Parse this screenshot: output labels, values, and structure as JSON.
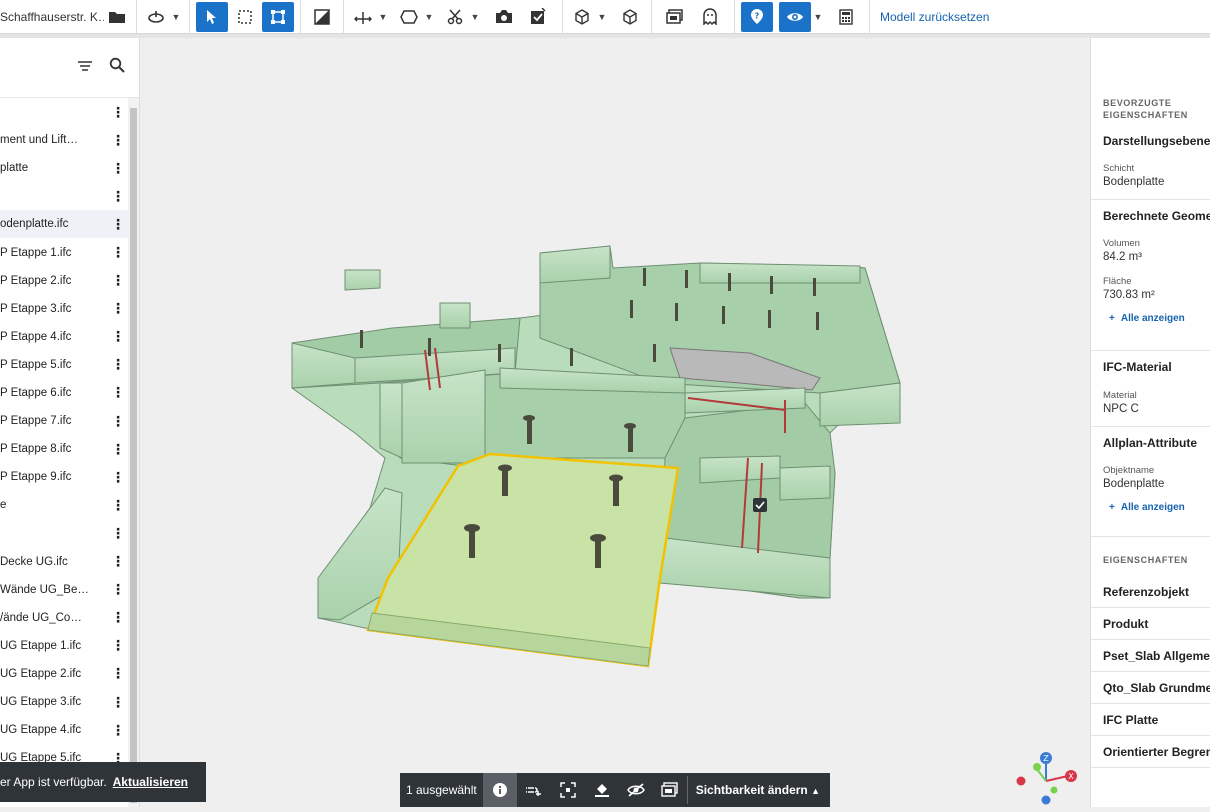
{
  "toolbar": {
    "title": "Schaffhauserstr. K…",
    "reset_label": "Modell zurücksetzen"
  },
  "tree": {
    "items": [
      {
        "label": ""
      },
      {
        "label": "ment und Lift…"
      },
      {
        "label": "platte"
      },
      {
        "label": ""
      },
      {
        "label": "odenplatte.ifc",
        "selected": true
      },
      {
        "label": "P Etappe 1.ifc"
      },
      {
        "label": "P Etappe 2.ifc"
      },
      {
        "label": "P Etappe 3.ifc"
      },
      {
        "label": "P Etappe 4.ifc"
      },
      {
        "label": "P Etappe 5.ifc"
      },
      {
        "label": "P Etappe 6.ifc"
      },
      {
        "label": "P Etappe 7.ifc"
      },
      {
        "label": "P Etappe 8.ifc"
      },
      {
        "label": "P Etappe 9.ifc"
      },
      {
        "label": "e"
      },
      {
        "label": ""
      },
      {
        "label": "Decke UG.ifc"
      },
      {
        "label": "Wände UG_Be…"
      },
      {
        "label": "/ände UG_Co…"
      },
      {
        "label": "UG Etappe 1.ifc"
      },
      {
        "label": "UG Etappe 2.ifc"
      },
      {
        "label": "UG Etappe 3.ifc"
      },
      {
        "label": "UG Etappe 4.ifc"
      },
      {
        "label": "UG Etappe 5.ifc"
      }
    ]
  },
  "toast": {
    "text": "er App ist verfügbar.",
    "action": "Aktualisieren"
  },
  "selection_bar": {
    "count_label": "1 ausgewählt",
    "visibility_label": "Sichtbarkeit ändern"
  },
  "properties": {
    "preferred_heading_1": "BEVORZUGTE",
    "preferred_heading_2": "EIGENSCHAFTEN",
    "groups": {
      "darstellung": {
        "title": "Darstellungsebenen",
        "key": "Schicht",
        "value": "Bodenplatte"
      },
      "geometrie": {
        "title": "Berechnete Geometrie",
        "k1": "Volumen",
        "v1": "84.2 m³",
        "k2": "Fläche",
        "v2": "730.83 m²",
        "more": "Alle anzeigen"
      },
      "material": {
        "title": "IFC-Material",
        "key": "Material",
        "value": "NPC C"
      },
      "allplan": {
        "title": "Allplan-Attribute",
        "key": "Objektname",
        "value": "Bodenplatte",
        "more": "Alle anzeigen"
      }
    },
    "properties_heading": "EIGENSCHAFTEN",
    "sections": [
      "Referenzobjekt",
      "Produkt",
      "Pset_Slab Allgemein",
      "Qto_Slab Grundmenge",
      "IFC Platte",
      "Orientierter Begrenzung"
    ]
  },
  "axes": {
    "z": "Z",
    "x": "X"
  },
  "colors": {
    "accent": "#1a73c8",
    "model": "#b9dcbb",
    "selection": "#f2c200"
  }
}
